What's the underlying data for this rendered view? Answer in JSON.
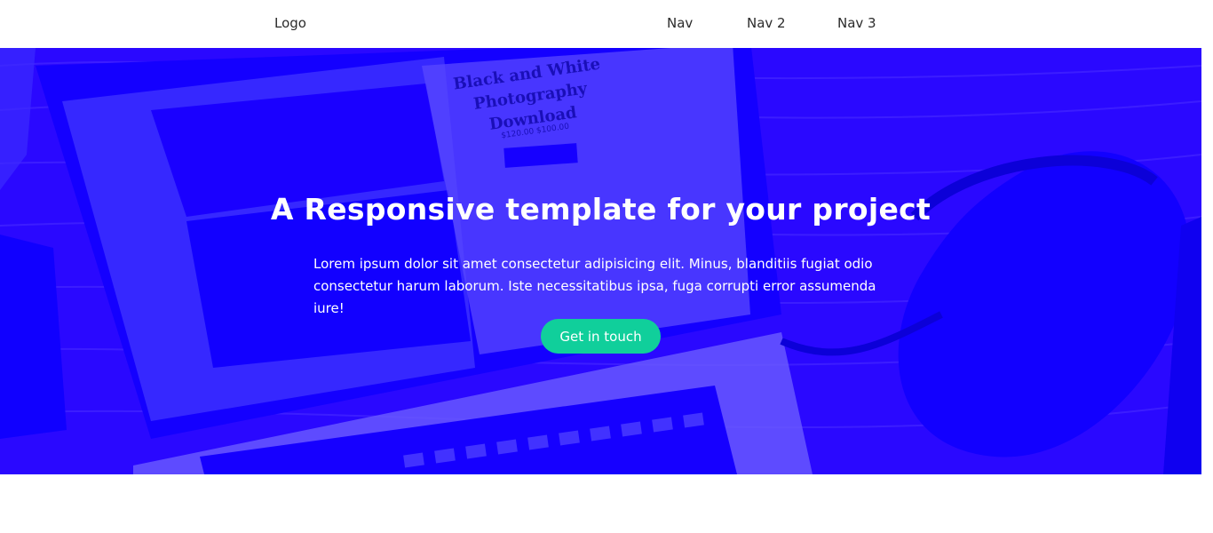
{
  "header": {
    "logo": "Logo",
    "nav": [
      "Nav",
      "Nav 2",
      "Nav 3"
    ]
  },
  "hero": {
    "title": "A Responsive template for your project",
    "text": "Lorem ipsum dolor sit amet consectetur adipisicing elit. Minus, blanditiis fugiat odio consectetur harum laborum. Iste necessitatibus ipsa, fuga corrupti error assumenda iure!",
    "cta": "Get in touch",
    "overlay_color": "#2a08ff",
    "cta_color": "#10cf9b",
    "photo_text": {
      "book_title_line1": "Black and White",
      "book_title_line2": "Photography",
      "book_title_line3": "Download",
      "price": "$120.00 $100.00"
    }
  }
}
